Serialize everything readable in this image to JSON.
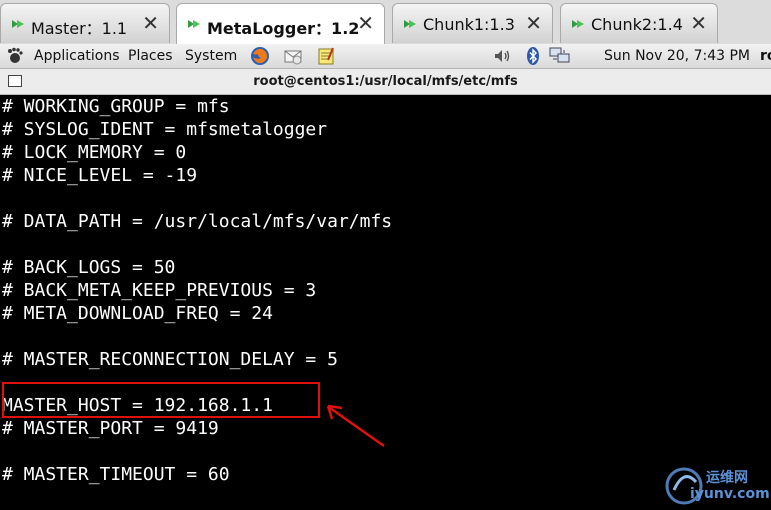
{
  "tabs": [
    {
      "label": "Master：1.1",
      "active": false
    },
    {
      "label": "MetaLogger：1.2",
      "active": true
    },
    {
      "label": "Chunk1:1.3",
      "active": false
    },
    {
      "label": "Chunk2:1.4",
      "active": false
    }
  ],
  "tab_close_glyph": "✕",
  "panel": {
    "menu": [
      "Applications",
      "Places",
      "System"
    ],
    "clock": "Sun Nov 20,  7:43 PM",
    "user_truncated": "ro",
    "launcher_icons": [
      "firefox-icon",
      "mail-icon",
      "notes-icon"
    ],
    "tray_icons": [
      "volume-icon",
      "bluetooth-icon",
      "network-icon"
    ]
  },
  "terminal": {
    "title": "root@centos1:/usr/local/mfs/etc/mfs",
    "lines": [
      "# WORKING_GROUP = mfs",
      "# SYSLOG_IDENT = mfsmetalogger",
      "# LOCK_MEMORY = 0",
      "# NICE_LEVEL = -19",
      "",
      "# DATA_PATH = /usr/local/mfs/var/mfs",
      "",
      "# BACK_LOGS = 50",
      "# BACK_META_KEEP_PREVIOUS = 3",
      "# META_DOWNLOAD_FREQ = 24",
      "",
      "# MASTER_RECONNECTION_DELAY = 5",
      "",
      "MASTER_HOST = 192.168.1.1",
      "# MASTER_PORT = 9419",
      "",
      "# MASTER_TIMEOUT = 60",
      ""
    ]
  },
  "annotation": {
    "color": "#e01010"
  },
  "watermark": {
    "line1": "运维网",
    "line2": "iyunv.com"
  },
  "colors": {
    "terminal_bg": "#000000",
    "terminal_fg": "#ffffff",
    "tab_icon": "#2e9e3f"
  }
}
